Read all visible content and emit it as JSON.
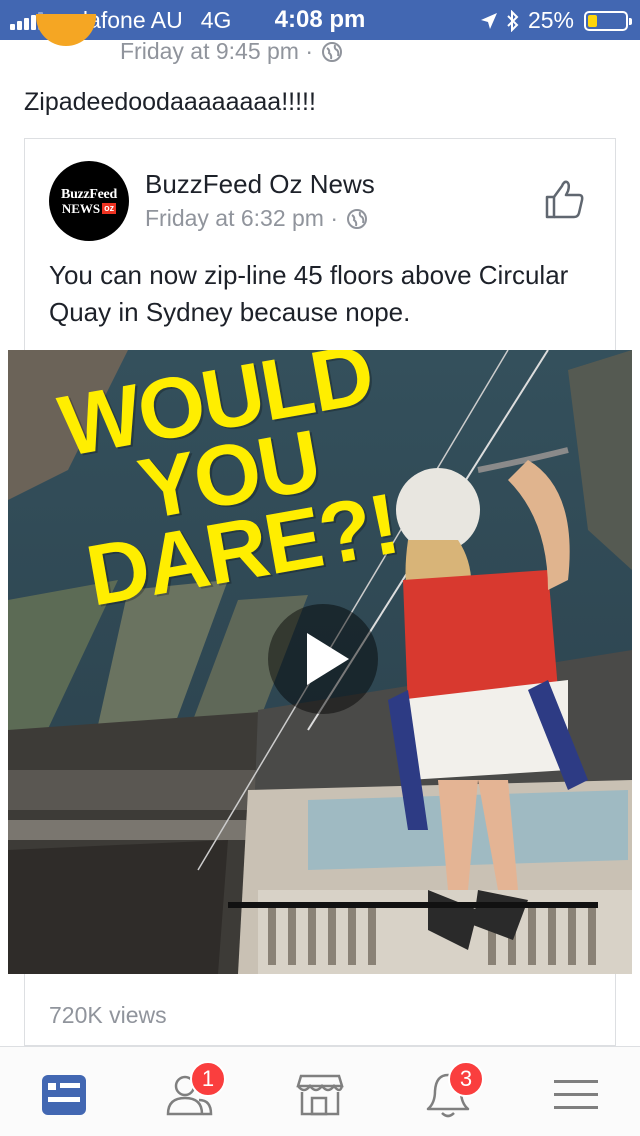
{
  "status_bar": {
    "carrier": "vodafone AU",
    "network": "4G",
    "time": "4:08 pm",
    "battery": "25%",
    "battery_level": 0.25
  },
  "post": {
    "timestamp": "Friday at 9:45 pm ·",
    "text": "Zipadeedoodaaaaaaaa!!!!!"
  },
  "shared": {
    "logo_line1": "BuzzFeed",
    "logo_line2": "NEWS",
    "logo_badge": "oz",
    "page_name": "BuzzFeed Oz News",
    "timestamp": "Friday at 6:32 pm ·",
    "text": "You can now zip-line 45 floors above Circular Quay in Sydney because nope."
  },
  "video": {
    "headline": [
      "WOULD",
      "YOU",
      "DARE?!"
    ],
    "views": "720K views"
  },
  "tab_bar": {
    "items": [
      {
        "name": "news-feed",
        "badge": ""
      },
      {
        "name": "friend-requests",
        "badge": "1"
      },
      {
        "name": "marketplace",
        "badge": ""
      },
      {
        "name": "notifications",
        "badge": "3"
      },
      {
        "name": "menu",
        "badge": ""
      }
    ]
  },
  "colors": {
    "brand": "#4267b2",
    "headline_yellow": "#ffee00",
    "badge_red": "#fa3e3e",
    "secondary_text": "#90949c"
  }
}
